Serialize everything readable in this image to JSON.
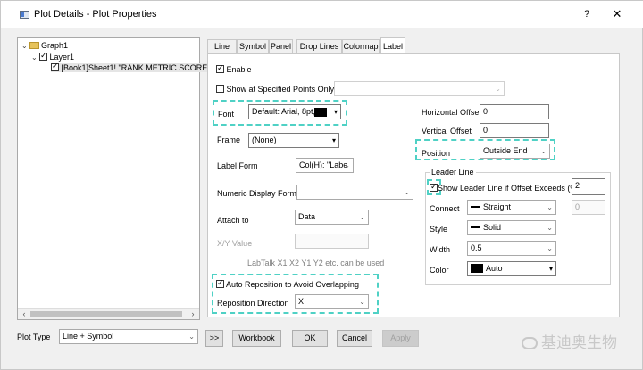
{
  "window": {
    "title": "Plot Details - Plot Properties",
    "help_label": "?",
    "close_label": "✕"
  },
  "tree": {
    "nodes": [
      {
        "label": "Graph1"
      },
      {
        "label": "Layer1"
      },
      {
        "label": "[Book1]Sheet1! \"RANK METRIC SCORE\"(c"
      }
    ]
  },
  "tabs": [
    "Line",
    "Symbol",
    "Panel",
    "Drop Lines",
    "Colormap",
    "Label"
  ],
  "active_tab": "Label",
  "label_tab": {
    "enable_label": "Enable",
    "enable_checked": true,
    "show_points_label": "Show at Specified Points Only",
    "show_points_checked": false,
    "font_label": "Font",
    "font_value": "Default: Arial, 8pt,",
    "frame_label": "Frame",
    "frame_value": "(None)",
    "label_form_label": "Label Form",
    "label_form_value": "Col(H): \"Labe",
    "numeric_format_label": "Numeric Display Format",
    "numeric_format_value": "",
    "attach_to_label": "Attach to",
    "attach_to_value": "Data",
    "xy_value_label": "X/Y Value",
    "labtalk_hint": "LabTalk X1 X2 Y1 Y2 etc. can be used",
    "auto_reposition_label": "Auto Reposition to Avoid Overlapping",
    "auto_reposition_checked": true,
    "reposition_direction_label": "Reposition Direction",
    "reposition_direction_value": "X",
    "horizontal_offset_label": "Horizontal Offset",
    "horizontal_offset_value": "0",
    "vertical_offset_label": "Vertical Offset",
    "vertical_offset_value": "0",
    "position_label": "Position",
    "position_value": "Outside End",
    "leader_line": {
      "group_label": "Leader Line",
      "show_label": "Show Leader Line if Offset Exceeds (%)",
      "show_checked": true,
      "threshold_value": "2",
      "secondary_value": "0",
      "connect_label": "Connect",
      "connect_value": "Straight",
      "style_label": "Style",
      "style_value": "Solid",
      "width_label": "Width",
      "width_value": "0.5",
      "color_label": "Color",
      "color_value": "Auto"
    }
  },
  "footer": {
    "plot_type_label": "Plot Type",
    "plot_type_value": "Line + Symbol",
    "expand_label": ">>",
    "workbook_label": "Workbook",
    "ok_label": "OK",
    "cancel_label": "Cancel",
    "apply_label": "Apply"
  },
  "watermark": {
    "text": "基迪奥生物"
  },
  "colors": {
    "highlight": "#4fd1c5",
    "swatch": "#000000"
  }
}
